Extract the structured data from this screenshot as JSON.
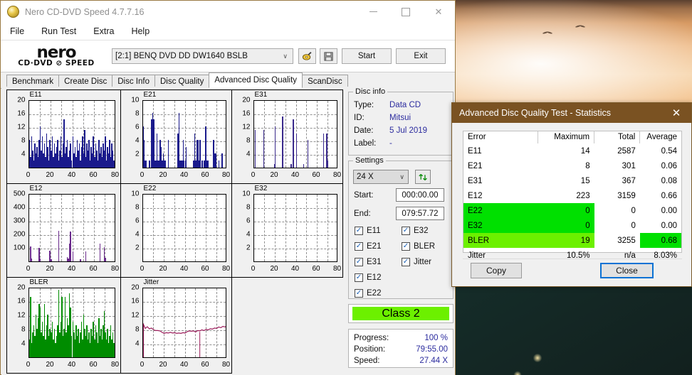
{
  "window": {
    "title": "Nero CD-DVD Speed 4.7.7.16",
    "icon": "nero-app-icon",
    "minimize": "minimize-icon",
    "maximize": "maximize-icon",
    "close": "close-icon"
  },
  "menubar": {
    "items": [
      "File",
      "Run Test",
      "Extra",
      "Help"
    ]
  },
  "toolbar": {
    "logo_top": "nero",
    "logo_bottom": "CD·DVD ⊘ SPEED",
    "drive": "[2:1]   BENQ DVD DD DW1640 BSLB",
    "drive_caret": "∨",
    "speed_icon": "disc-speed-icon",
    "save_icon": "save-icon",
    "start_label": "Start",
    "exit_label": "Exit"
  },
  "tabs": {
    "items": [
      "Benchmark",
      "Create Disc",
      "Disc Info",
      "Disc Quality",
      "Advanced Disc Quality",
      "ScanDisc"
    ],
    "active": "Advanced Disc Quality"
  },
  "disc_info": {
    "legend": "Disc info",
    "rows": [
      {
        "key": "Type:",
        "value": "Data CD"
      },
      {
        "key": "ID:",
        "value": "Mitsui"
      },
      {
        "key": "Date:",
        "value": "5 Jul 2019"
      },
      {
        "key": "Label:",
        "value": "-"
      }
    ]
  },
  "settings": {
    "legend": "Settings",
    "speed": "24 X",
    "speed_caret": "∨",
    "refresh_icon": "refresh-icon",
    "start_label": "Start:",
    "start_value": "000:00.00",
    "end_label": "End:",
    "end_value": "079:57.72",
    "checkboxes_left": [
      {
        "label": "E11",
        "checked": true
      },
      {
        "label": "E21",
        "checked": true
      },
      {
        "label": "E31",
        "checked": true
      },
      {
        "label": "E12",
        "checked": true
      },
      {
        "label": "E22",
        "checked": true
      }
    ],
    "checkboxes_right": [
      {
        "label": "E32",
        "checked": true
      },
      {
        "label": "BLER",
        "checked": true
      },
      {
        "label": "Jitter",
        "checked": true
      }
    ],
    "check_glyph": "✓"
  },
  "class_result": {
    "label": "Class 2",
    "color": "#6cf000"
  },
  "progress": {
    "rows": [
      {
        "key": "Progress:",
        "value": "100 %"
      },
      {
        "key": "Position:",
        "value": "79:55.00"
      },
      {
        "key": "Speed:",
        "value": "27.44 X"
      }
    ]
  },
  "stats_dialog": {
    "title": "Advanced Disc Quality Test - Statistics",
    "close_icon": "close-icon",
    "title_color": "#7a5222",
    "highlight_color": "#00e000",
    "highlight_color_light": "#6cf000",
    "headers": [
      "Error",
      "Maximum",
      "Total",
      "Average"
    ],
    "rows": [
      {
        "error": "E11",
        "maximum": "14",
        "total": "2587",
        "average": "0.54",
        "hl": "none"
      },
      {
        "error": "E21",
        "maximum": "8",
        "total": "301",
        "average": "0.06",
        "hl": "none"
      },
      {
        "error": "E31",
        "maximum": "15",
        "total": "367",
        "average": "0.08",
        "hl": "none"
      },
      {
        "error": "E12",
        "maximum": "223",
        "total": "3159",
        "average": "0.66",
        "hl": "none"
      },
      {
        "error": "E22",
        "maximum": "0",
        "total": "0",
        "average": "0.00",
        "hl": "left"
      },
      {
        "error": "E32",
        "maximum": "0",
        "total": "0",
        "average": "0.00",
        "hl": "left"
      },
      {
        "error": "BLER",
        "maximum": "19",
        "total": "3255",
        "average": "0.68",
        "hl": "left-light-and-avg"
      },
      {
        "error": "Jitter",
        "maximum": "10.5%",
        "total": "n/a",
        "average": "8.03%",
        "hl": "none"
      }
    ],
    "copy_label": "Copy",
    "close_label": "Close"
  },
  "chart_data": [
    {
      "type": "bar",
      "title": "E11",
      "color": "#1a1a8c",
      "xlabel": "",
      "ylabel": "",
      "xlim": [
        0,
        80
      ],
      "ylim": [
        0,
        20
      ],
      "xticks": [
        0,
        20,
        40,
        60,
        80
      ],
      "yticks": [
        4,
        8,
        12,
        16,
        20
      ],
      "grid": true,
      "x": [
        0,
        1,
        2,
        3,
        4,
        5,
        6,
        7,
        8,
        9,
        10,
        11,
        12,
        13,
        14,
        15,
        16,
        17,
        18,
        19,
        20,
        21,
        22,
        23,
        24,
        25,
        26,
        27,
        28,
        29,
        30,
        31,
        32,
        33,
        34,
        35,
        36,
        37,
        38,
        39,
        40,
        41,
        42,
        43,
        44,
        45,
        46,
        47,
        48,
        49,
        50,
        51,
        52,
        53,
        54,
        55,
        56,
        57,
        58,
        59,
        60,
        61,
        62,
        63,
        64,
        65,
        66,
        67,
        68,
        69,
        70,
        71,
        72,
        73,
        74,
        75,
        76,
        77,
        78,
        79
      ],
      "values": [
        8,
        3,
        9,
        5,
        2,
        7,
        4,
        6,
        3,
        8,
        12,
        5,
        9,
        4,
        7,
        3,
        10,
        6,
        2,
        8,
        5,
        9,
        3,
        7,
        4,
        6,
        8,
        2,
        5,
        9,
        3,
        7,
        14,
        4,
        6,
        8,
        3,
        5,
        7,
        2,
        9,
        4,
        6,
        3,
        8,
        5,
        7,
        2,
        6,
        9,
        4,
        11,
        3,
        7,
        5,
        8,
        2,
        6,
        4,
        9,
        3,
        7,
        5,
        2,
        8,
        4,
        6,
        3,
        7,
        5,
        9,
        2,
        6,
        4,
        8,
        3,
        7,
        5,
        2,
        6
      ]
    },
    {
      "type": "bar",
      "title": "E21",
      "color": "#1a1a8c",
      "xlabel": "",
      "ylabel": "",
      "xlim": [
        0,
        80
      ],
      "ylim": [
        0,
        10
      ],
      "xticks": [
        0,
        20,
        40,
        60,
        80
      ],
      "yticks": [
        2,
        4,
        6,
        8,
        10
      ],
      "grid": true,
      "x": [
        0,
        1,
        2,
        3,
        4,
        5,
        6,
        7,
        8,
        9,
        10,
        11,
        12,
        13,
        14,
        15,
        16,
        17,
        18,
        19,
        20,
        21,
        22,
        23,
        24,
        25,
        26,
        27,
        28,
        29,
        30,
        31,
        32,
        33,
        34,
        35,
        36,
        37,
        38,
        39,
        40,
        41,
        42,
        43,
        44,
        45,
        46,
        47,
        48,
        49,
        50,
        51,
        52,
        53,
        54,
        55,
        56,
        57,
        58,
        59,
        60,
        61,
        62,
        63,
        64,
        65,
        66,
        67,
        68,
        69,
        70,
        71,
        72,
        73,
        74,
        75,
        76,
        77,
        78,
        79
      ],
      "values": [
        6,
        4,
        1,
        1,
        0,
        0,
        1,
        0,
        7,
        8,
        7,
        1,
        1,
        5,
        1,
        1,
        4,
        3,
        1,
        2,
        1,
        1,
        0,
        0,
        4,
        0,
        0,
        0,
        0,
        0,
        0,
        0,
        0,
        5,
        8,
        1,
        1,
        1,
        4,
        1,
        1,
        3,
        0,
        0,
        0,
        0,
        0,
        0,
        1,
        5,
        1,
        4,
        4,
        1,
        4,
        0,
        1,
        0,
        1,
        6,
        6,
        1,
        1,
        0,
        0,
        0,
        0,
        4,
        2,
        2,
        0,
        0,
        1,
        0,
        0,
        2,
        0,
        0,
        0,
        2
      ]
    },
    {
      "type": "bar",
      "title": "E31",
      "color": "#3a2a8c",
      "xlabel": "",
      "ylabel": "",
      "xlim": [
        0,
        80
      ],
      "ylim": [
        0,
        20
      ],
      "xticks": [
        0,
        20,
        40,
        60,
        80
      ],
      "yticks": [
        4,
        8,
        12,
        16,
        20
      ],
      "grid": true,
      "x": [
        0,
        1,
        2,
        3,
        4,
        5,
        6,
        7,
        8,
        9,
        10,
        11,
        12,
        13,
        14,
        15,
        16,
        17,
        18,
        19,
        20,
        21,
        22,
        23,
        24,
        25,
        26,
        27,
        28,
        29,
        30,
        31,
        32,
        33,
        34,
        35,
        36,
        37,
        38,
        39,
        40,
        41,
        42,
        43,
        44,
        45,
        46,
        47,
        48,
        49,
        50,
        51,
        52,
        53,
        54,
        55,
        56,
        57,
        58,
        59,
        60,
        61,
        62,
        63,
        64,
        65,
        66,
        67,
        68,
        69,
        70,
        71,
        72,
        73,
        74,
        75,
        76,
        77,
        78,
        79
      ],
      "values": [
        0,
        11,
        0,
        0,
        0,
        0,
        0,
        0,
        0,
        11,
        0,
        0,
        0,
        0,
        0,
        0,
        0,
        0,
        0,
        1,
        12,
        0,
        0,
        0,
        0,
        0,
        0,
        15,
        0,
        0,
        0,
        0,
        0,
        0,
        0,
        1,
        0,
        14,
        0,
        0,
        10,
        0,
        0,
        0,
        0,
        0,
        0,
        1,
        0,
        0,
        0,
        8,
        0,
        0,
        0,
        0,
        0,
        0,
        0,
        0,
        0,
        0,
        0,
        0,
        0,
        0,
        10,
        0,
        0,
        10,
        2,
        0,
        0,
        0,
        0,
        0,
        0,
        0,
        0,
        5
      ]
    },
    {
      "type": "bar",
      "title": "E12",
      "color": "#6a2a8c",
      "xlabel": "",
      "ylabel": "",
      "xlim": [
        0,
        80
      ],
      "ylim": [
        0,
        500
      ],
      "xticks": [
        0,
        20,
        40,
        60,
        80
      ],
      "yticks": [
        100,
        200,
        300,
        400,
        500
      ],
      "grid": true,
      "x": [
        0,
        1,
        2,
        3,
        4,
        5,
        6,
        7,
        8,
        9,
        10,
        11,
        12,
        13,
        14,
        15,
        16,
        17,
        18,
        19,
        20,
        21,
        22,
        23,
        24,
        25,
        26,
        27,
        28,
        29,
        30,
        31,
        32,
        33,
        34,
        35,
        36,
        37,
        38,
        39,
        40,
        41,
        42,
        43,
        44,
        45,
        46,
        47,
        48,
        49,
        50,
        51,
        52,
        53,
        54,
        55,
        56,
        57,
        58,
        59,
        60,
        61,
        62,
        63,
        64,
        65,
        66,
        67,
        68,
        69,
        70,
        71,
        72,
        73,
        74,
        75,
        76,
        77,
        78,
        79
      ],
      "values": [
        0,
        105,
        20,
        0,
        0,
        0,
        0,
        0,
        0,
        95,
        20,
        0,
        0,
        0,
        0,
        0,
        0,
        0,
        0,
        75,
        12,
        0,
        0,
        0,
        0,
        0,
        0,
        220,
        0,
        0,
        0,
        0,
        0,
        0,
        0,
        30,
        20,
        130,
        215,
        0,
        70,
        0,
        0,
        0,
        0,
        0,
        0,
        15,
        0,
        0,
        0,
        0,
        70,
        0,
        0,
        0,
        0,
        0,
        0,
        0,
        0,
        0,
        0,
        0,
        0,
        130,
        0,
        0,
        0,
        100,
        25,
        0,
        0,
        0,
        0,
        0,
        0,
        0,
        0,
        25
      ]
    },
    {
      "type": "bar",
      "title": "E22",
      "color": "#1a1a8c",
      "xlabel": "",
      "ylabel": "",
      "xlim": [
        0,
        80
      ],
      "ylim": [
        0,
        10
      ],
      "xticks": [
        0,
        20,
        40,
        60,
        80
      ],
      "yticks": [
        2,
        4,
        6,
        8,
        10
      ],
      "grid": true,
      "x": [],
      "values": []
    },
    {
      "type": "bar",
      "title": "E32",
      "color": "#1a1a8c",
      "xlabel": "",
      "ylabel": "",
      "xlim": [
        0,
        80
      ],
      "ylim": [
        0,
        10
      ],
      "xticks": [
        0,
        20,
        40,
        60,
        80
      ],
      "yticks": [
        2,
        4,
        6,
        8,
        10
      ],
      "grid": true,
      "x": [],
      "values": []
    },
    {
      "type": "bar",
      "title": "BLER",
      "color": "#008c00",
      "xlabel": "",
      "ylabel": "",
      "xlim": [
        0,
        80
      ],
      "ylim": [
        0,
        20
      ],
      "xticks": [
        0,
        20,
        40,
        60,
        80
      ],
      "yticks": [
        4,
        8,
        12,
        16,
        20
      ],
      "grid": true,
      "x": [
        0,
        1,
        2,
        3,
        4,
        5,
        6,
        7,
        8,
        9,
        10,
        11,
        12,
        13,
        14,
        15,
        16,
        17,
        18,
        19,
        20,
        21,
        22,
        23,
        24,
        25,
        26,
        27,
        28,
        29,
        30,
        31,
        32,
        33,
        34,
        35,
        36,
        37,
        38,
        39,
        40,
        41,
        42,
        43,
        44,
        45,
        46,
        47,
        48,
        49,
        50,
        51,
        52,
        53,
        54,
        55,
        56,
        57,
        58,
        59,
        60,
        61,
        62,
        63,
        64,
        65,
        66,
        67,
        68,
        69,
        70,
        71,
        72,
        73,
        74,
        75,
        76,
        77,
        78,
        79
      ],
      "values": [
        5,
        17,
        4,
        7,
        9,
        6,
        12,
        8,
        11,
        15,
        14,
        7,
        10,
        6,
        15,
        5,
        9,
        12,
        6,
        8,
        7,
        10,
        5,
        8,
        4,
        6,
        9,
        19,
        7,
        10,
        17,
        6,
        8,
        17,
        7,
        11,
        9,
        18,
        14,
        6,
        10,
        7,
        5,
        9,
        6,
        8,
        4,
        7,
        10,
        5,
        12,
        8,
        6,
        9,
        5,
        7,
        4,
        8,
        6,
        10,
        5,
        9,
        7,
        4,
        11,
        6,
        8,
        5,
        9,
        13,
        7,
        5,
        8,
        4,
        6,
        9,
        5,
        7,
        4,
        7
      ]
    },
    {
      "type": "line",
      "title": "Jitter",
      "color": "#9b1b5a",
      "xlabel": "",
      "ylabel": "",
      "xlim": [
        0,
        80
      ],
      "ylim": [
        0,
        20
      ],
      "xticks": [
        0,
        20,
        40,
        60,
        80
      ],
      "yticks": [
        4,
        8,
        12,
        16,
        20
      ],
      "grid": true,
      "x": [
        0,
        2,
        4,
        6,
        8,
        10,
        12,
        14,
        16,
        18,
        20,
        22,
        24,
        26,
        28,
        30,
        32,
        34,
        36,
        38,
        40,
        42,
        44,
        46,
        48,
        50,
        52,
        54,
        56,
        58,
        60,
        62,
        64,
        66,
        68,
        70,
        72,
        74,
        76,
        78,
        80
      ],
      "values": [
        10.0,
        8.6,
        9.1,
        8.5,
        8.7,
        8.2,
        8.0,
        8.0,
        7.9,
        7.5,
        7.2,
        7.4,
        7.3,
        7.5,
        7.3,
        7.4,
        7.2,
        7.3,
        7.2,
        7.4,
        7.3,
        7.7,
        7.9,
        7.8,
        7.9,
        7.6,
        8.0,
        7.9,
        8.2,
        8.0,
        8.3,
        8.2,
        8.5,
        8.4,
        8.7,
        8.6,
        9.0,
        8.8,
        9.2,
        9.0,
        9.3
      ]
    }
  ]
}
